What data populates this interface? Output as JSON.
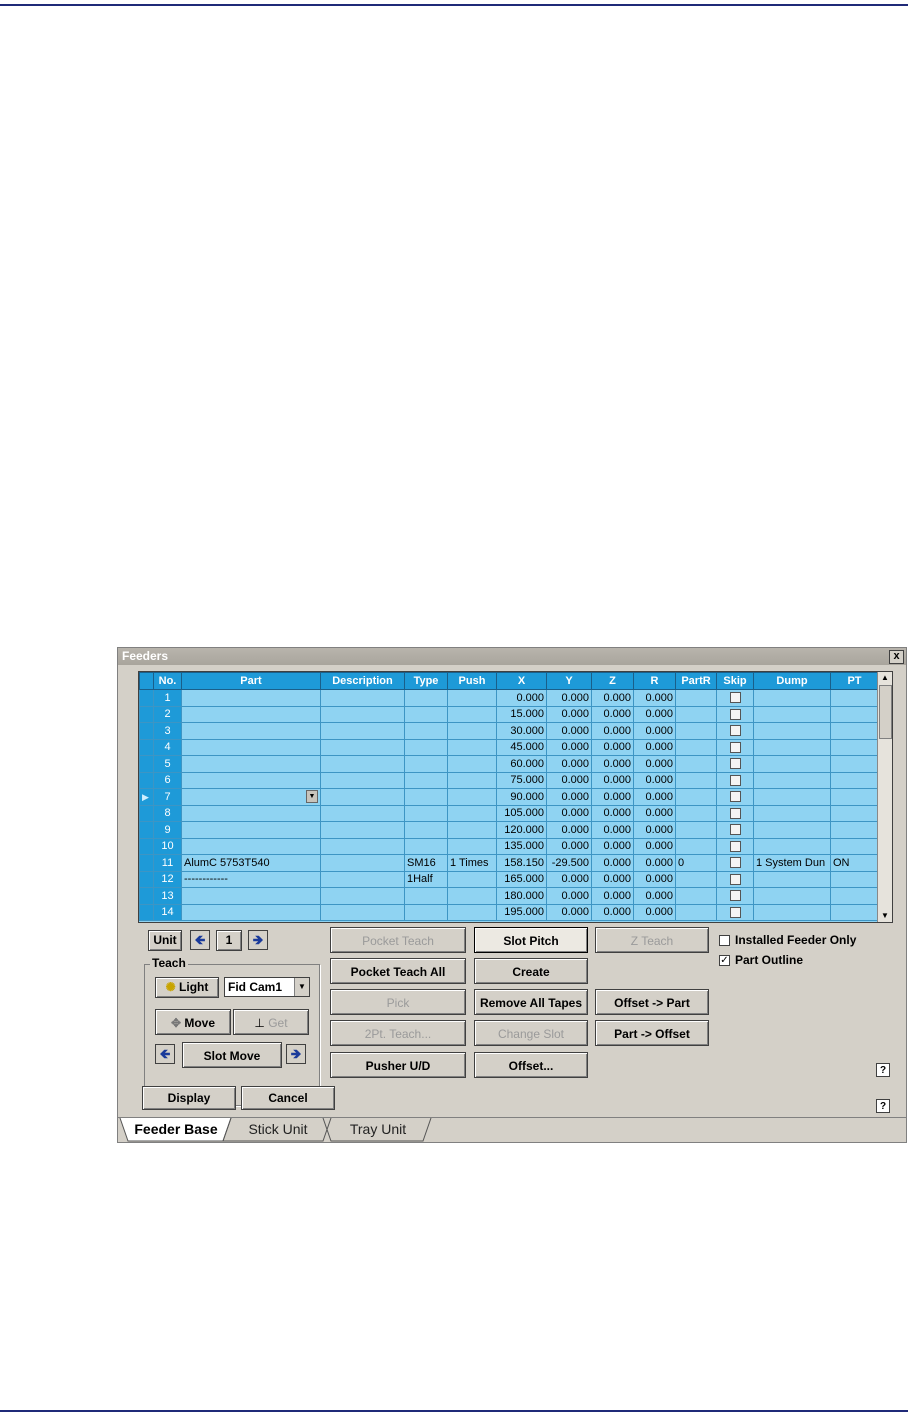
{
  "window": {
    "title": "Feeders",
    "close_label": "x"
  },
  "callout": "1",
  "grid": {
    "headers": [
      "No.",
      "Part",
      "Description",
      "Type",
      "Push",
      "X",
      "Y",
      "Z",
      "R",
      "PartR",
      "Skip",
      "Dump",
      "PT"
    ],
    "rows": [
      {
        "no": "1",
        "part": "",
        "desc": "",
        "type": "",
        "push": "",
        "x": "0.000",
        "y": "0.000",
        "z": "0.000",
        "r": "0.000",
        "partr": "",
        "dump": "",
        "pt": ""
      },
      {
        "no": "2",
        "part": "",
        "desc": "",
        "type": "",
        "push": "",
        "x": "15.000",
        "y": "0.000",
        "z": "0.000",
        "r": "0.000",
        "partr": "",
        "dump": "",
        "pt": ""
      },
      {
        "no": "3",
        "part": "",
        "desc": "",
        "type": "",
        "push": "",
        "x": "30.000",
        "y": "0.000",
        "z": "0.000",
        "r": "0.000",
        "partr": "",
        "dump": "",
        "pt": ""
      },
      {
        "no": "4",
        "part": "",
        "desc": "",
        "type": "",
        "push": "",
        "x": "45.000",
        "y": "0.000",
        "z": "0.000",
        "r": "0.000",
        "partr": "",
        "dump": "",
        "pt": ""
      },
      {
        "no": "5",
        "part": "",
        "desc": "",
        "type": "",
        "push": "",
        "x": "60.000",
        "y": "0.000",
        "z": "0.000",
        "r": "0.000",
        "partr": "",
        "dump": "",
        "pt": ""
      },
      {
        "no": "6",
        "part": "",
        "desc": "",
        "type": "",
        "push": "",
        "x": "75.000",
        "y": "0.000",
        "z": "0.000",
        "r": "0.000",
        "partr": "",
        "dump": "",
        "pt": ""
      },
      {
        "no": "7",
        "part": "",
        "desc": "",
        "type": "",
        "push": "",
        "x": "90.000",
        "y": "0.000",
        "z": "0.000",
        "r": "0.000",
        "partr": "",
        "dump": "",
        "pt": ""
      },
      {
        "no": "8",
        "part": "",
        "desc": "",
        "type": "",
        "push": "",
        "x": "105.000",
        "y": "0.000",
        "z": "0.000",
        "r": "0.000",
        "partr": "",
        "dump": "",
        "pt": ""
      },
      {
        "no": "9",
        "part": "",
        "desc": "",
        "type": "",
        "push": "",
        "x": "120.000",
        "y": "0.000",
        "z": "0.000",
        "r": "0.000",
        "partr": "",
        "dump": "",
        "pt": ""
      },
      {
        "no": "10",
        "part": "",
        "desc": "",
        "type": "",
        "push": "",
        "x": "135.000",
        "y": "0.000",
        "z": "0.000",
        "r": "0.000",
        "partr": "",
        "dump": "",
        "pt": ""
      },
      {
        "no": "11",
        "part": "AlumC 5753T540",
        "desc": "",
        "type": "SM16",
        "push": "1 Times",
        "x": "158.150",
        "y": "-29.500",
        "z": "0.000",
        "r": "0.000",
        "partr": "0",
        "dump": "1 System Dun",
        "pt": "ON"
      },
      {
        "no": "12",
        "part": "------------",
        "desc": "",
        "type": "1Half",
        "push": "",
        "x": "165.000",
        "y": "0.000",
        "z": "0.000",
        "r": "0.000",
        "partr": "",
        "dump": "",
        "pt": ""
      },
      {
        "no": "13",
        "part": "",
        "desc": "",
        "type": "",
        "push": "",
        "x": "180.000",
        "y": "0.000",
        "z": "0.000",
        "r": "0.000",
        "partr": "",
        "dump": "",
        "pt": ""
      },
      {
        "no": "14",
        "part": "",
        "desc": "",
        "type": "",
        "push": "",
        "x": "195.000",
        "y": "0.000",
        "z": "0.000",
        "r": "0.000",
        "partr": "",
        "dump": "",
        "pt": ""
      }
    ]
  },
  "unit": {
    "label": "Unit",
    "value": "1"
  },
  "teach": {
    "group_label": "Teach",
    "light_label": "Light",
    "camera_value": "Fid Cam1",
    "move_label": "Move",
    "get_label": "Get",
    "slot_move_label": "Slot Move"
  },
  "buttons": {
    "pocket_teach": "Pocket Teach",
    "pocket_teach_all": "Pocket Teach All",
    "pick": "Pick",
    "two_pt_teach": "2Pt. Teach...",
    "pusher_ud": "Pusher U/D",
    "slot_pitch": "Slot Pitch",
    "create": "Create",
    "remove_all_tapes": "Remove All Tapes",
    "change_slot": "Change Slot",
    "offset": "Offset...",
    "z_teach": "Z Teach",
    "offset_to_part": "Offset -> Part",
    "part_to_offset": "Part -> Offset",
    "display": "Display",
    "cancel": "Cancel"
  },
  "options": {
    "installed_feeder_only": "Installed Feeder Only",
    "part_outline": "Part Outline",
    "installed_checked": false,
    "outline_checked": true
  },
  "help_label": "?",
  "tabs": [
    "Feeder Base",
    "Stick Unit",
    "Tray Unit"
  ]
}
